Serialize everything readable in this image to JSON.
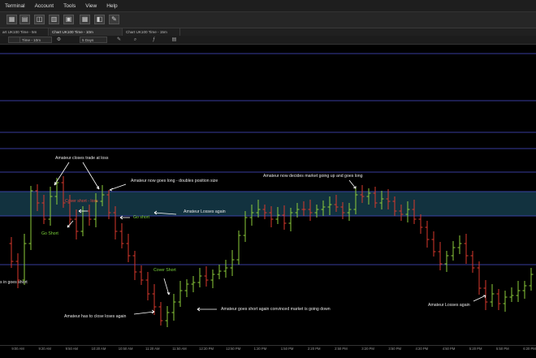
{
  "menu": [
    "Terminal",
    "Account",
    "Tools",
    "View",
    "Help"
  ],
  "tabs": [
    {
      "label": "art UK100 Time - 5m"
    },
    {
      "label": "Chart UK100 Time - 10m"
    },
    {
      "label": "Chart UK100 Time - 15m"
    }
  ],
  "controls": {
    "time_label": "Time - 10m",
    "range_label": "5 Days"
  },
  "colors": {
    "up_bar": "#8ccc3a",
    "down_bar": "#d8392c",
    "level_line": "#4a4fcf",
    "zone_fill": "#12323f",
    "background": "#000000",
    "annotation_white": "#e8e8e8",
    "annotation_green": "#7bd43a",
    "annotation_red": "#e3443a",
    "arrow": "#ffffff"
  },
  "annotations": {
    "closes_at_loss": "Amateur closes trade at loss",
    "goes_long_doubles": "Amateur now goes long - doubles position size",
    "decides_market_up": "Amateur now decides market going up and goes long",
    "cover_short_top": "Cover short - loss",
    "go_short_2": "Go short",
    "loses_again": "Amateur Losses again",
    "go_short_1": "Go Short",
    "goes_short_left": "s in goes short",
    "cover_short_bottom": "Cover Short",
    "close_loses_again": "Amateur has to close loses again",
    "goes_short_convinced": "Amateur goes short again convinced market is going down",
    "losses_again_right": "Amateur Losses again"
  },
  "xaxis_ticks": [
    "9:00 AM",
    "9:20 AM",
    "9:50 AM",
    "10:20 AM",
    "10:50 AM",
    "11:20 AM",
    "11:50 AM",
    "12:20 PM",
    "12:50 PM",
    "1:20 PM",
    "1:50 PM",
    "2:20 PM",
    "2:50 PM",
    "3:20 PM",
    "3:50 PM",
    "4:20 PM",
    "4:50 PM",
    "5:20 PM",
    "5:50 PM",
    "6:20 PM"
  ]
}
